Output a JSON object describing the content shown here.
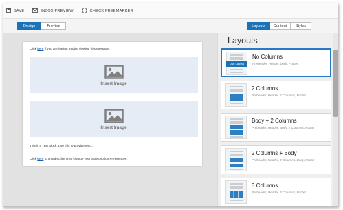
{
  "toolbar": {
    "save_label": "SAVE",
    "inbox_preview_label": "INBOX PREVIEW",
    "check_freemarker_label": "CHECK FREEMARKER"
  },
  "view_tabs": {
    "design": "Design",
    "preview": "Preview"
  },
  "panel_tabs": {
    "layouts": "Layouts",
    "content": "Content",
    "styles": "Styles"
  },
  "email": {
    "top_prefix": "Click ",
    "top_link": "here",
    "top_suffix": " if you are having trouble viewing this message.",
    "image_label_1": "Insert Image",
    "image_label_2": "Insert Image",
    "text_block": "This is a Text Block. Use this to provide text...",
    "bottom_prefix": "Click ",
    "bottom_link": "here",
    "bottom_suffix": " to unsubscribe or to change your Subscription Preferences."
  },
  "panel": {
    "title": "Layouts",
    "use_layout_label": "Use Layout",
    "layouts": [
      {
        "name": "No Columns",
        "desc": "Preheader, Header, body, Footer"
      },
      {
        "name": "2 Columns",
        "desc": "Preheader, Header, 2 Columns, Footer"
      },
      {
        "name": "Body + 2 Columns",
        "desc": "Preheader, Header, Body, 2 Columns, Footer"
      },
      {
        "name": "2 Columns + Body",
        "desc": "Preheader, Header, 2 Columns, Body, Footer"
      },
      {
        "name": "3 Columns",
        "desc": "Preheader, Header, 3 Columns, Footer"
      }
    ]
  },
  "colors": {
    "accent": "#1a73b8",
    "image_block": "#e6ecf5"
  }
}
